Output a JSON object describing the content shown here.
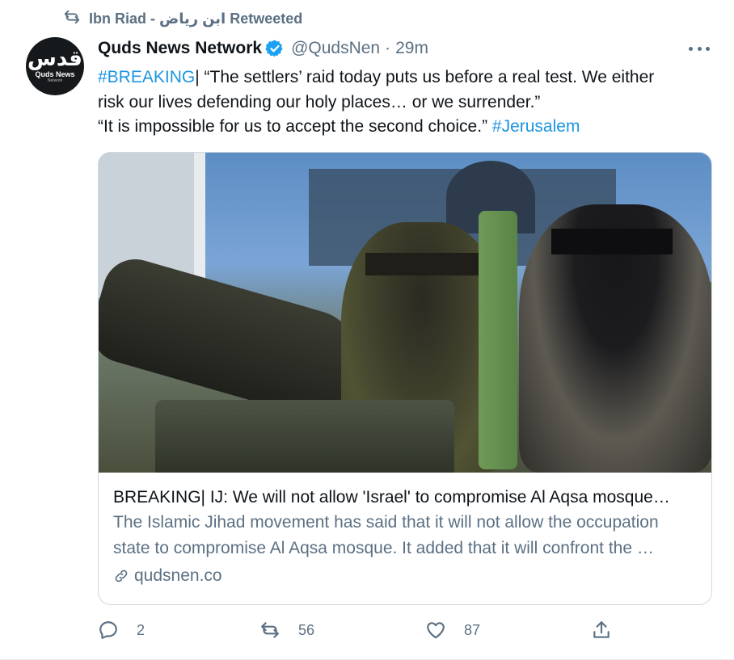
{
  "retweet_banner": {
    "text": "Ibn Riad - ابن رياض Retweeted"
  },
  "author": {
    "avatar_logo": "قدس",
    "avatar_name": "Quds News",
    "avatar_sub": "Network",
    "name": "Quds News Network",
    "handle": "@QudsNen",
    "separator": "·",
    "time": "29m",
    "verified": true
  },
  "tweet": {
    "lines": [
      {
        "hashtag": "#BREAKING",
        "text": "| “The settlers’ raid today puts us before a real test. We either"
      },
      {
        "text": "risk our lives defending our holy places… or we surrender.”"
      },
      {
        "text": "“It is impossible for us to accept the second choice.” ",
        "hashtag": "#Jerusalem"
      }
    ]
  },
  "card": {
    "title": "BREAKING| IJ: We will not allow 'Israel' to compromise Al Aqsa mosque…",
    "description_lines": [
      "The Islamic Jihad movement has said that it will not allow the occupation",
      "state to compromise Al Aqsa mosque. It added that it will confront the …"
    ],
    "domain": "qudsnen.co"
  },
  "actions": {
    "reply_count": "2",
    "retweet_count": "56",
    "like_count": "87"
  },
  "colors": {
    "link": "#1b95e0",
    "secondary_text": "#5b7083",
    "verified_badge": "#1da1f2"
  },
  "icons": [
    "retweet-icon",
    "verified-badge-icon",
    "more-options-icon",
    "link-icon",
    "reply-icon",
    "like-icon",
    "share-icon"
  ]
}
